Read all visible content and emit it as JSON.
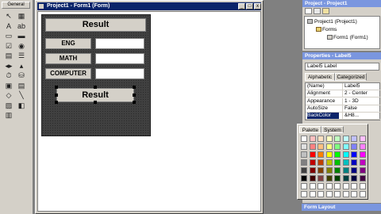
{
  "toolbox": {
    "title": "General",
    "tools": [
      {
        "icon": "pointer-icon",
        "glyph": "↖"
      },
      {
        "icon": "picturebox-icon",
        "glyph": "▦"
      },
      {
        "icon": "label-tool-icon",
        "glyph": "A"
      },
      {
        "icon": "textbox-tool-icon",
        "glyph": "ab"
      },
      {
        "icon": "frame-tool-icon",
        "glyph": "▭"
      },
      {
        "icon": "button-tool-icon",
        "glyph": "▬"
      },
      {
        "icon": "checkbox-tool-icon",
        "glyph": "☑"
      },
      {
        "icon": "option-tool-icon",
        "glyph": "◉"
      },
      {
        "icon": "combobox-tool-icon",
        "glyph": "▤"
      },
      {
        "icon": "listbox-tool-icon",
        "glyph": "☰"
      },
      {
        "icon": "hscroll-tool-icon",
        "glyph": "◂▸"
      },
      {
        "icon": "vscroll-tool-icon",
        "glyph": "▴"
      },
      {
        "icon": "timer-tool-icon",
        "glyph": "⏱"
      },
      {
        "icon": "drivelist-tool-icon",
        "glyph": "⛁"
      },
      {
        "icon": "dirlist-tool-icon",
        "glyph": "▣"
      },
      {
        "icon": "filelist-tool-icon",
        "glyph": "▤"
      },
      {
        "icon": "shape-tool-icon",
        "glyph": "◇"
      },
      {
        "icon": "line-tool-icon",
        "glyph": "╲"
      },
      {
        "icon": "image-tool-icon",
        "glyph": "▨"
      },
      {
        "icon": "data-tool-icon",
        "glyph": "◧"
      },
      {
        "icon": "ole-tool-icon",
        "glyph": "▥"
      }
    ]
  },
  "designer": {
    "title": "Project1 - Form1 (Form)",
    "min": "_",
    "max": "□",
    "close": "x"
  },
  "form": {
    "result_label": "Result",
    "eng_label": "ENG",
    "math_label": "MATH",
    "computer_label": "COMPUTER",
    "result_selected_label": "Result"
  },
  "project": {
    "title": "Project - Project1",
    "tree": [
      "Project1 (Project1)",
      "Forms",
      "Form1 (Form1)"
    ]
  },
  "properties": {
    "title": "Properties - Label5",
    "object": "Label5  Label",
    "tabs": [
      "Alphabetic",
      "Categorized"
    ],
    "rows": [
      {
        "k": "(Name)",
        "v": "Label5"
      },
      {
        "k": "Alignment",
        "v": "2 - Center"
      },
      {
        "k": "Appearance",
        "v": "1 - 3D"
      },
      {
        "k": "AutoSize",
        "v": "False"
      },
      {
        "k": "BackColor",
        "v": "&H8..."
      }
    ]
  },
  "palette": {
    "tabs": [
      "Palette",
      "System"
    ],
    "colors": [
      "#ffffff",
      "#ffc0c0",
      "#ffe0c0",
      "#ffffc0",
      "#c0ffc0",
      "#c0ffff",
      "#c0c0ff",
      "#ffc0ff",
      "#e0e0e0",
      "#ff8080",
      "#ffc080",
      "#ffff80",
      "#80ff80",
      "#80ffff",
      "#8080ff",
      "#ff80ff",
      "#c0c0c0",
      "#ff0000",
      "#ff8000",
      "#ffff00",
      "#00ff00",
      "#00ffff",
      "#0000ff",
      "#ff00ff",
      "#808080",
      "#c00000",
      "#c04000",
      "#c0c000",
      "#00c000",
      "#00c0c0",
      "#0000c0",
      "#c000c0",
      "#404040",
      "#800000",
      "#804000",
      "#808000",
      "#008000",
      "#008080",
      "#000080",
      "#800080",
      "#000000",
      "#400000",
      "#804040",
      "#404000",
      "#004000",
      "#004040",
      "#000040",
      "#400040",
      "#ffffff",
      "#ffffff",
      "#ffffff",
      "#ffffff",
      "#ffffff",
      "#ffffff",
      "#ffffff",
      "#ffffff",
      "#ffffff",
      "#ffffff",
      "#ffffff",
      "#ffffff",
      "#ffffff",
      "#ffffff",
      "#ffffff",
      "#ffffff"
    ]
  },
  "form_layout": {
    "title": "Form Layout"
  }
}
